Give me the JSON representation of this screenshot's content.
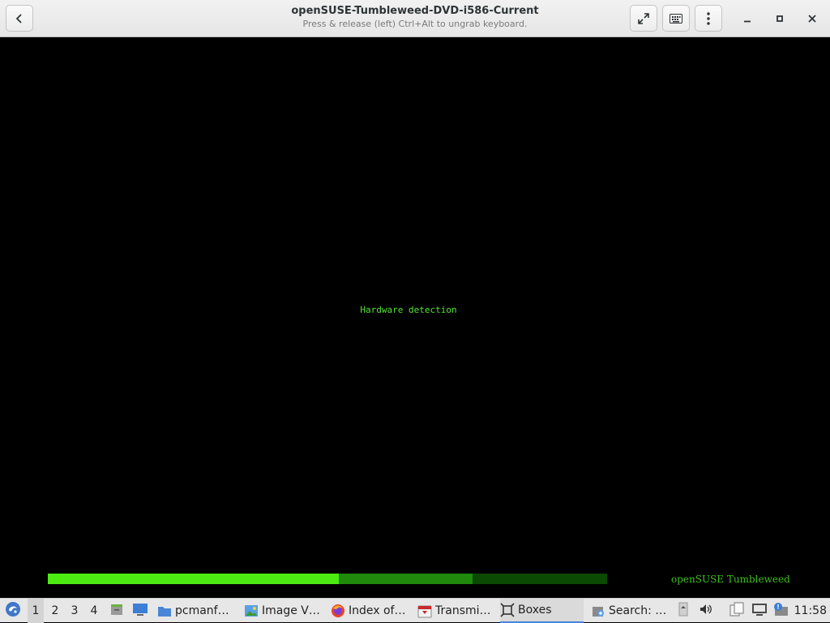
{
  "header": {
    "title": "openSUSE-Tumbleweed-DVD-i586-Current",
    "subtitle": "Press & release (left) Ctrl+Alt to ungrab keyboard."
  },
  "vm": {
    "status_text": "Hardware detection",
    "brand_text": "openSUSE Tumbleweed",
    "progress": {
      "done_fraction": 0.52,
      "partial_fraction": 0.76
    },
    "colors": {
      "done": "#4ceb12",
      "partial": "#1f8a0c",
      "remaining": "#0b4a02"
    }
  },
  "taskbar": {
    "workspaces": [
      "1",
      "2",
      "3",
      "4"
    ],
    "tasks": [
      {
        "label": "pcmanf…",
        "icon": "folder-icon"
      },
      {
        "label": "Image V…",
        "icon": "image-viewer-icon"
      },
      {
        "label": "Index of…",
        "icon": "firefox-icon"
      },
      {
        "label": "Transmi…",
        "icon": "transmission-icon"
      },
      {
        "label": "Boxes",
        "icon": "boxes-icon"
      },
      {
        "label": "Search: …",
        "icon": "search-app-icon"
      }
    ],
    "clock": "11:58"
  }
}
